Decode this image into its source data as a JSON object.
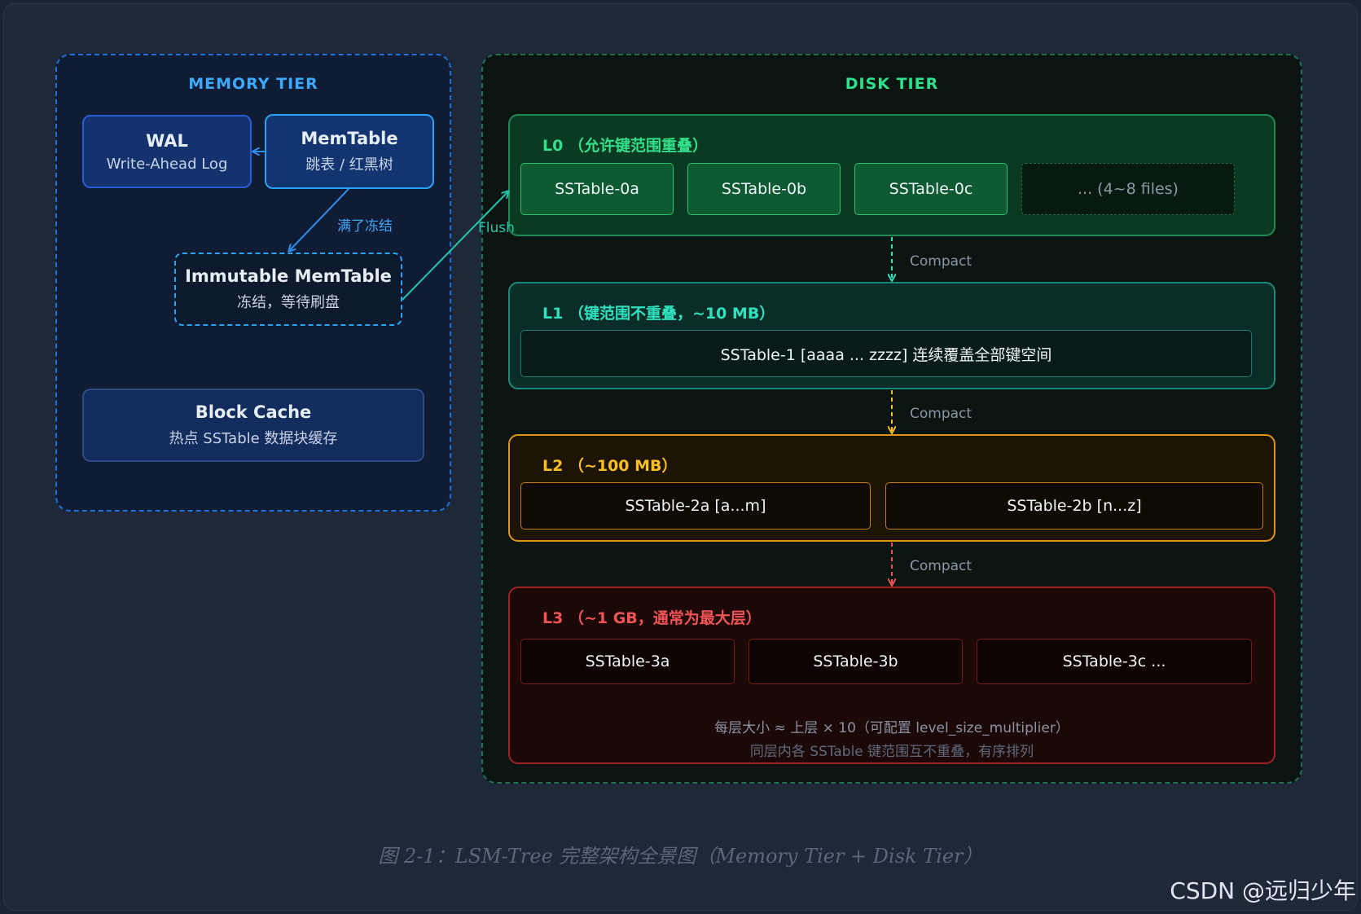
{
  "memory_tier": {
    "title": "MEMORY TIER",
    "wal": {
      "title": "WAL",
      "subtitle": "Write-Ahead Log"
    },
    "memtable": {
      "title": "MemTable",
      "subtitle": "跳表 / 红黑树"
    },
    "freeze_label": "满了冻结",
    "immutable": {
      "title": "Immutable MemTable",
      "subtitle": "冻结，等待刷盘"
    },
    "block_cache": {
      "title": "Block Cache",
      "subtitle": "热点 SSTable 数据块缓存"
    }
  },
  "flush_label": "Flush",
  "disk_tier": {
    "title": "DISK TIER",
    "compact_label": "Compact",
    "l0": {
      "title": "L0 （允许键范围重叠）",
      "tables": [
        "SSTable-0a",
        "SSTable-0b",
        "SSTable-0c"
      ],
      "more": "... (4~8 files)"
    },
    "l1": {
      "title": "L1 （键范围不重叠，~10 MB）",
      "table": "SSTable-1 [aaaa ... zzzz] 连续覆盖全部键空间"
    },
    "l2": {
      "title": "L2 （~100 MB）",
      "tables": [
        "SSTable-2a [a...m]",
        "SSTable-2b [n...z]"
      ]
    },
    "l3": {
      "title": "L3 （~1 GB，通常为最大层）",
      "tables": [
        "SSTable-3a",
        "SSTable-3b",
        "SSTable-3c ..."
      ]
    },
    "note_line1": "每层大小 ≈ 上层 × 10（可配置 level_size_multiplier）",
    "note_line2": "同层内各 SSTable 键范围互不重叠，有序排列"
  },
  "caption": "图 2-1：LSM-Tree 完整架构全景图（Memory Tier + Disk Tier）",
  "watermark": "CSDN @远归少年",
  "colors": {
    "memory": "#1e88e5",
    "l0": "#22c55e",
    "l1": "#1abc9c",
    "l2": "#f59e0b",
    "l3": "#ef4444"
  }
}
